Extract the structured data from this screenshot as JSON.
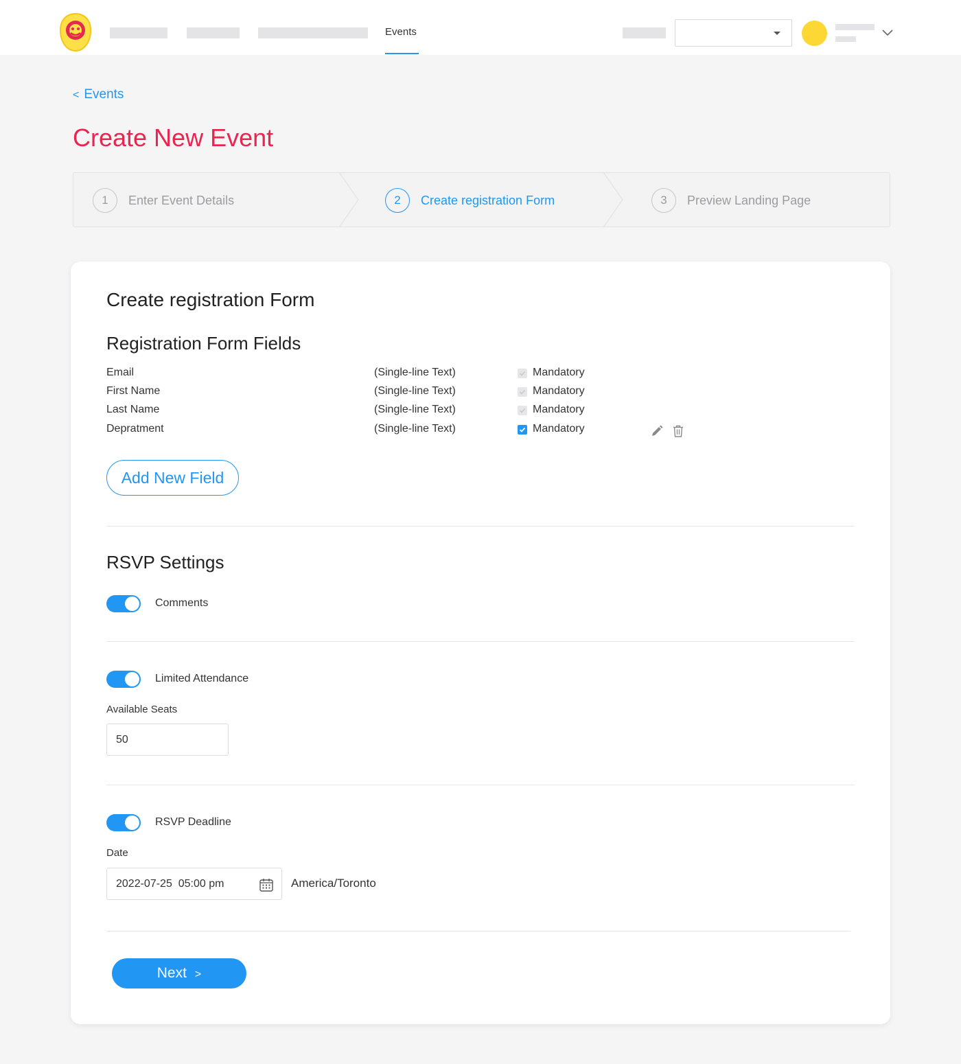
{
  "nav": {
    "active_item": "Events",
    "select_value": "",
    "avatar_color": "#fdd835",
    "accent_color": "#2196f3"
  },
  "breadcrumb": {
    "back_symbol": "<",
    "label": "Events"
  },
  "page_title": "Create New Event",
  "title_color": "#e8264f",
  "stepper": {
    "steps": [
      {
        "number": "1",
        "label": "Enter Event Details",
        "state": "inactive"
      },
      {
        "number": "2",
        "label": "Create registration Form",
        "state": "active"
      },
      {
        "number": "3",
        "label": "Preview Landing Page",
        "state": "inactive"
      }
    ]
  },
  "card": {
    "title": "Create registration Form",
    "fields_section": {
      "title": "Registration Form Fields",
      "fields": [
        {
          "name": "Email",
          "type": "(Single-line Text)",
          "mandatory_label": "Mandatory",
          "mandatory_checked": true,
          "locked": true
        },
        {
          "name": "First Name",
          "type": "(Single-line Text)",
          "mandatory_label": "Mandatory",
          "mandatory_checked": true,
          "locked": true
        },
        {
          "name": "Last Name",
          "type": "(Single-line Text)",
          "mandatory_label": "Mandatory",
          "mandatory_checked": true,
          "locked": true
        },
        {
          "name": "Depratment",
          "type": "(Single-line Text)",
          "mandatory_label": "Mandatory",
          "mandatory_checked": true,
          "locked": false
        }
      ],
      "add_button": "Add New Field",
      "edit_icon": "pencil-icon",
      "delete_icon": "trash-icon"
    },
    "rsvp": {
      "title": "RSVP Settings",
      "comments": {
        "label": "Comments",
        "enabled": true
      },
      "limited_attendance": {
        "label": "Limited Attendance",
        "enabled": true,
        "seats_label": "Available Seats",
        "seats_value": "50"
      },
      "deadline": {
        "label": "RSVP Deadline",
        "enabled": true,
        "date_label": "Date",
        "date_value": "2022-07-25  05:00 pm",
        "calendar_icon": "calendar-icon",
        "timezone": "America/Toronto"
      }
    },
    "next_button": {
      "label": "Next",
      "symbol": ">"
    }
  }
}
